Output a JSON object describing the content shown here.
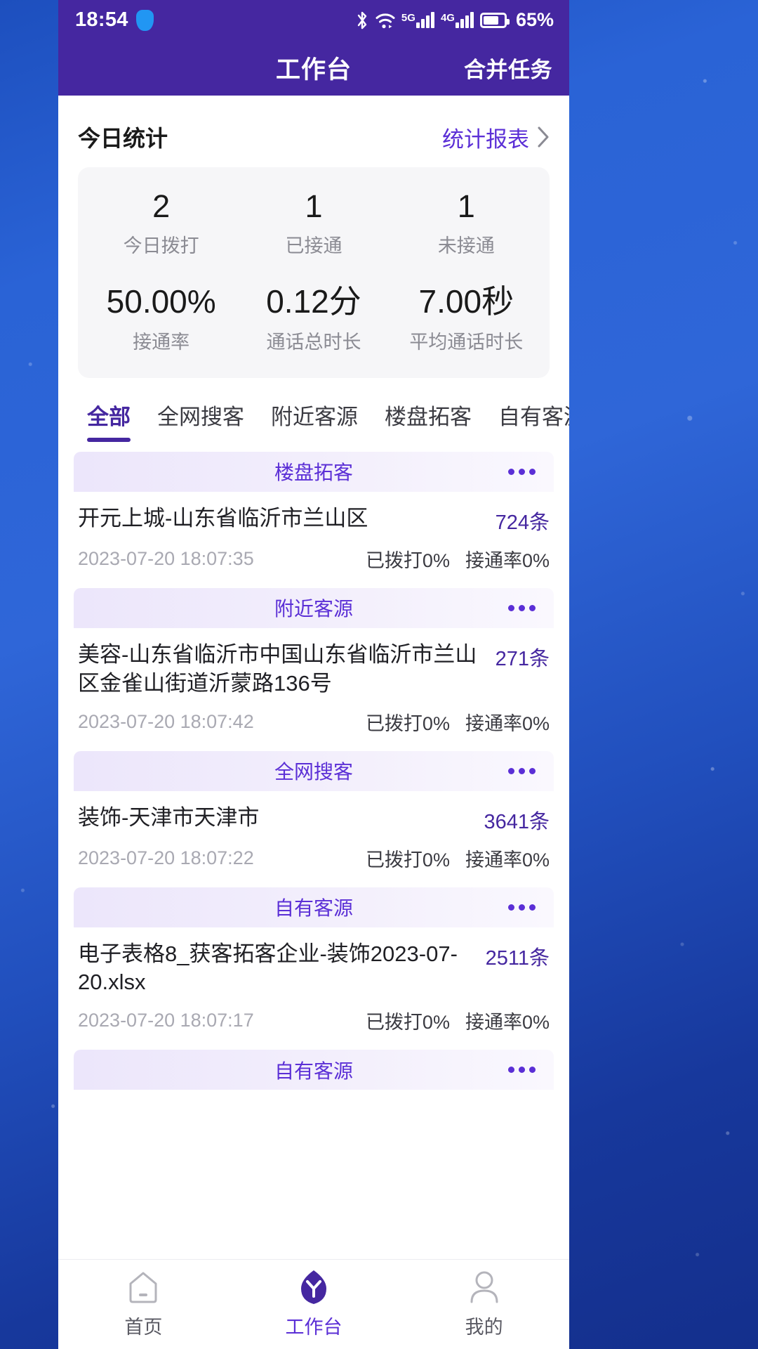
{
  "statusbar": {
    "time": "18:54",
    "shield_icon": "shield-icon",
    "bluetooth_icon": "bluetooth-icon",
    "wifi_icon": "wifi-icon",
    "sim1_label": "5G",
    "sim2_label": "4G",
    "battery_icon": "battery-icon",
    "battery_percent": "65%"
  },
  "appbar": {
    "title": "工作台",
    "action_label": "合并任务"
  },
  "today": {
    "section_title": "今日统计",
    "report_link": "统计报表",
    "chevron_icon": "chevron-right-icon",
    "stats": [
      {
        "value": "2",
        "label": "今日拨打"
      },
      {
        "value": "1",
        "label": "已接通"
      },
      {
        "value": "1",
        "label": "未接通"
      },
      {
        "value": "50.00%",
        "label": "接通率"
      },
      {
        "value": "0.12分",
        "label": "通话总时长"
      },
      {
        "value": "7.00秒",
        "label": "平均通话时长"
      }
    ]
  },
  "tabs": [
    {
      "label": "全部",
      "active": true
    },
    {
      "label": "全网搜客",
      "active": false
    },
    {
      "label": "附近客源",
      "active": false
    },
    {
      "label": "楼盘拓客",
      "active": false
    },
    {
      "label": "自有客源",
      "active": false
    }
  ],
  "tasks": [
    {
      "type": "楼盘拓客",
      "more_icon": "more-horizontal-icon",
      "name": "开元上城-山东省临沂市兰山区",
      "count": "724条",
      "time": "2023-07-20 18:07:35",
      "dialed": "已拨打0%",
      "connect_rate": "接通率0%"
    },
    {
      "type": "附近客源",
      "more_icon": "more-horizontal-icon",
      "name": "美容-山东省临沂市中国山东省临沂市兰山区金雀山街道沂蒙路136号",
      "count": "271条",
      "time": "2023-07-20 18:07:42",
      "dialed": "已拨打0%",
      "connect_rate": "接通率0%"
    },
    {
      "type": "全网搜客",
      "more_icon": "more-horizontal-icon",
      "name": "装饰-天津市天津市",
      "count": "3641条",
      "time": "2023-07-20 18:07:22",
      "dialed": "已拨打0%",
      "connect_rate": "接通率0%"
    },
    {
      "type": "自有客源",
      "more_icon": "more-horizontal-icon",
      "name": "电子表格8_获客拓客企业-装饰2023-07-20.xlsx",
      "count": "2511条",
      "time": "2023-07-20 18:07:17",
      "dialed": "已拨打0%",
      "connect_rate": "接通率0%"
    },
    {
      "type": "自有客源",
      "more_icon": "more-horizontal-icon",
      "name": "",
      "count": "",
      "time": "",
      "dialed": "",
      "connect_rate": ""
    }
  ],
  "tabbar": [
    {
      "label": "首页",
      "icon": "home-icon",
      "active": false
    },
    {
      "label": "工作台",
      "icon": "workbench-icon",
      "active": true
    },
    {
      "label": "我的",
      "icon": "person-icon",
      "active": false
    }
  ],
  "colors": {
    "appbar_purple": "#4527a0",
    "accent_purple": "#5b2fd6",
    "wallpaper_blue": "#2a63d6",
    "card_gray": "#f6f6f8"
  }
}
